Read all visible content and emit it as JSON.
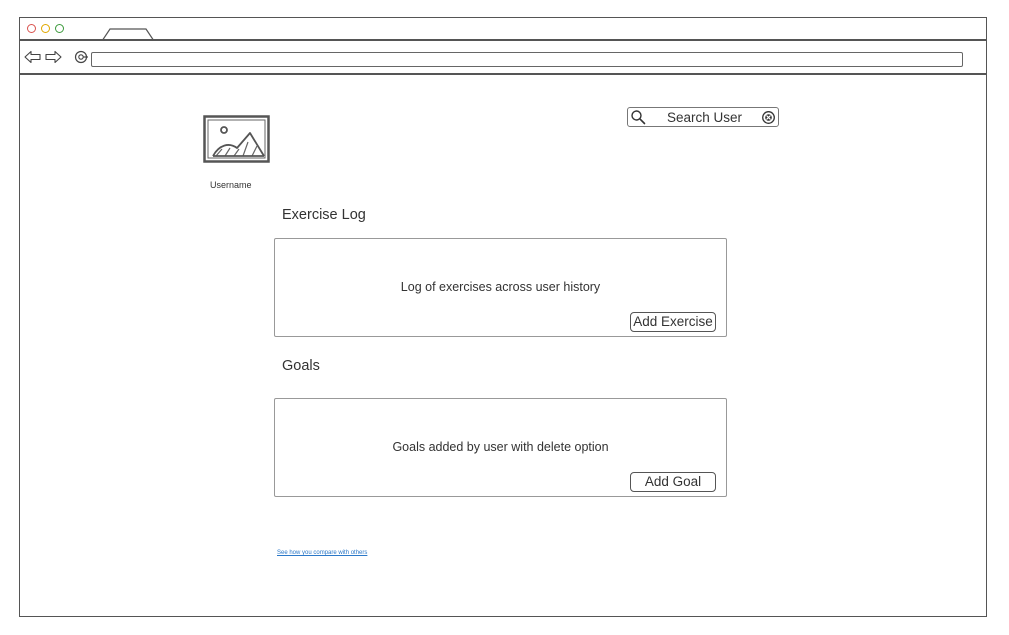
{
  "window": {
    "traffic_lights": {
      "close_color": "#d9534f",
      "minimize_color": "#e0a800",
      "maximize_color": "#3c9a3c"
    }
  },
  "profile": {
    "avatar_icon": "image-placeholder-icon",
    "username": "Username"
  },
  "search": {
    "icon": "search-icon",
    "label": "Search User",
    "clear_icon": "clear-circle-x-icon"
  },
  "exercise_log": {
    "title": "Exercise Log",
    "description": "Log of exercises across user history",
    "button_label": "Add Exercise"
  },
  "goals": {
    "title": "Goals",
    "description": "Goals added by user with delete option",
    "button_label": "Add Goal"
  },
  "footer": {
    "compare_link": "See how you compare with others",
    "link_color": "#2b78c8"
  }
}
